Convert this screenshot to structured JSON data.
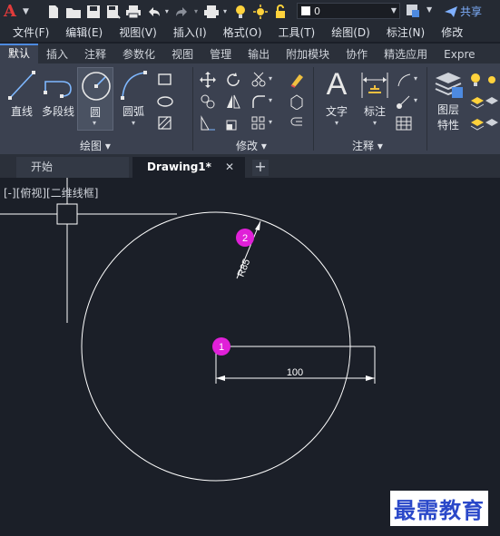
{
  "app": {
    "logo": "A",
    "share_label": "共享",
    "layer_value": "0"
  },
  "menu": [
    "文件(F)",
    "编辑(E)",
    "视图(V)",
    "插入(I)",
    "格式(O)",
    "工具(T)",
    "绘图(D)",
    "标注(N)",
    "修改"
  ],
  "ribbon_tabs": [
    "默认",
    "插入",
    "注释",
    "参数化",
    "视图",
    "管理",
    "输出",
    "附加模块",
    "协作",
    "精选应用",
    "Expre"
  ],
  "ribbon": {
    "draw": {
      "title": "绘图 ▾",
      "line": "直线",
      "polyline": "多段线",
      "circle": "圆",
      "arc": "圆弧"
    },
    "modify": {
      "title": "修改 ▾"
    },
    "annotate": {
      "title": "注释 ▾",
      "text": "文字",
      "dimension": "标注"
    },
    "layers": {
      "line1": "图层",
      "line2": "特性"
    }
  },
  "doc_tabs": {
    "start": "开始",
    "current": "Drawing1*",
    "close": "✕",
    "add": "+"
  },
  "canvas": {
    "view_label": "[-][俯视][二维线框]",
    "radius_label": "R85",
    "dim_label": "100",
    "marker1": "1",
    "marker2": "2",
    "watermark": "最需教育"
  },
  "colors": {
    "accent": "#4d8ae0",
    "marker": "#e020d8",
    "logo": "#e23b3b",
    "watermark": "#2a48c9"
  }
}
